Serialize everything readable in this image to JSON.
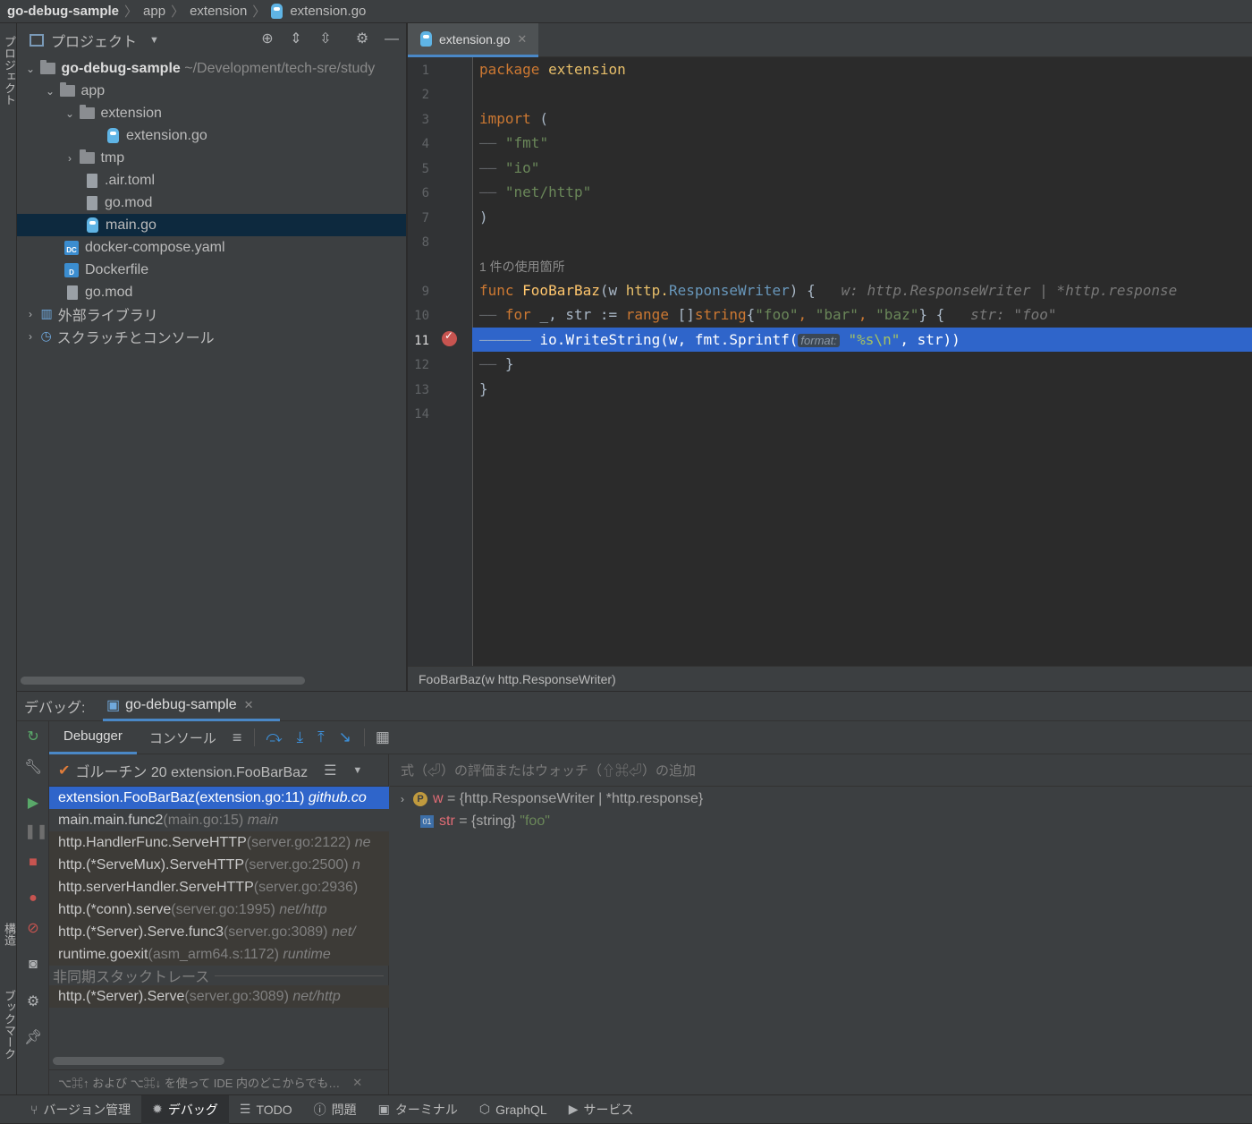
{
  "breadcrumb": {
    "items": [
      "go-debug-sample",
      "app",
      "extension",
      "extension.go"
    ]
  },
  "left_strip": {
    "top_label": "プロジェクト",
    "mid_label": "構造",
    "bottom_label": "ブックマーク"
  },
  "project": {
    "title": "プロジェクト",
    "tree": [
      {
        "label": "go-debug-sample",
        "path": "~/Development/tech-sre/study"
      },
      {
        "label": "app"
      },
      {
        "label": "extension"
      },
      {
        "label": "extension.go"
      },
      {
        "label": "tmp"
      },
      {
        "label": ".air.toml"
      },
      {
        "label": "go.mod"
      },
      {
        "label": "main.go"
      },
      {
        "label": "docker-compose.yaml"
      },
      {
        "label": "Dockerfile"
      },
      {
        "label": "go.mod"
      },
      {
        "label": "外部ライブラリ"
      },
      {
        "label": "スクラッチとコンソール"
      }
    ]
  },
  "editor": {
    "tab": "extension.go",
    "line_numbers": [
      "1",
      "2",
      "3",
      "4",
      "5",
      "6",
      "7",
      "8",
      "9",
      "10",
      "11",
      "12",
      "13",
      "14"
    ],
    "code": {
      "l1_kw": "package",
      "l1_name": " extension",
      "l3_kw": "import",
      "l3_rest": " (",
      "l4": "\"fmt\"",
      "l5": "\"io\"",
      "l6": "\"net/http\"",
      "l7": ")",
      "usage": "1 件の使用箇所",
      "l9_kw": "func",
      "l9_fn": " FooBarBaz",
      "l9_a": "(w ",
      "l9_pkg": "http.",
      "l9_typ": "ResponseWriter",
      "l9_b": ") {",
      "l9_hint": "w: http.ResponseWriter | *http.response",
      "l10_kw": "for",
      "l10_a": " _, str := ",
      "l10_kw2": "range",
      "l10_b": " []",
      "l10_kw3": "string",
      "l10_c": "{",
      "l10_s1": "\"foo\"",
      "l10_d": ", ",
      "l10_s2": "\"bar\"",
      "l10_e": ", ",
      "l10_s3": "\"baz\"",
      "l10_f": "} {",
      "l10_hint": "str: \"foo\"",
      "l11_a": "io.WriteString(w, fmt.Sprintf(",
      "l11_inl": "format:",
      "l11_str": "\"%s\\n\"",
      "l11_b": ", str))",
      "l12": "}",
      "l13": "}"
    },
    "footer": "FooBarBaz(w http.ResponseWriter)"
  },
  "debug": {
    "label": "デバッグ:",
    "session": "go-debug-sample",
    "tabs": {
      "debugger": "Debugger",
      "console": "コンソール"
    },
    "thread": "ゴルーチン 20 extension.FooBarBaz",
    "watch_placeholder": "式（⏎）の評価またはウォッチ（⇧⌘⏎）の追加",
    "frames": [
      {
        "main": "extension.FooBarBaz",
        "loc": " (extension.go:11)",
        "pkg": "github.co"
      },
      {
        "main": "main.main.func2",
        "loc": " (main.go:15)",
        "pkg": "main"
      },
      {
        "main": "http.HandlerFunc.ServeHTTP",
        "loc": " (server.go:2122)",
        "pkg": "ne"
      },
      {
        "main": "http.(*ServeMux).ServeHTTP",
        "loc": " (server.go:2500)",
        "pkg": "n"
      },
      {
        "main": "http.serverHandler.ServeHTTP",
        "loc": " (server.go:2936)",
        "pkg": ""
      },
      {
        "main": "http.(*conn).serve",
        "loc": " (server.go:1995)",
        "pkg": "net/http"
      },
      {
        "main": "http.(*Server).Serve.func3",
        "loc": " (server.go:3089)",
        "pkg": "net/"
      },
      {
        "main": "runtime.goexit",
        "loc": " (asm_arm64.s:1172)",
        "pkg": "runtime"
      }
    ],
    "async_label": "非同期スタックトレース",
    "async_frame": {
      "main": "http.(*Server).Serve",
      "loc": " (server.go:3089)",
      "pkg": "net/http"
    },
    "hint": "⌥⌘↑ および ⌥⌘↓ を使って IDE 内のどこからでも…",
    "variables": [
      {
        "name": "w",
        "value": "= {http.ResponseWriter | *http.response}",
        "badge": "P"
      },
      {
        "name": "str",
        "value": "= {string}",
        "str": "\"foo\"",
        "badge": "01"
      }
    ]
  },
  "statusbar": {
    "items": [
      "バージョン管理",
      "デバッグ",
      "TODO",
      "問題",
      "ターミナル",
      "GraphQL",
      "サービス"
    ]
  }
}
